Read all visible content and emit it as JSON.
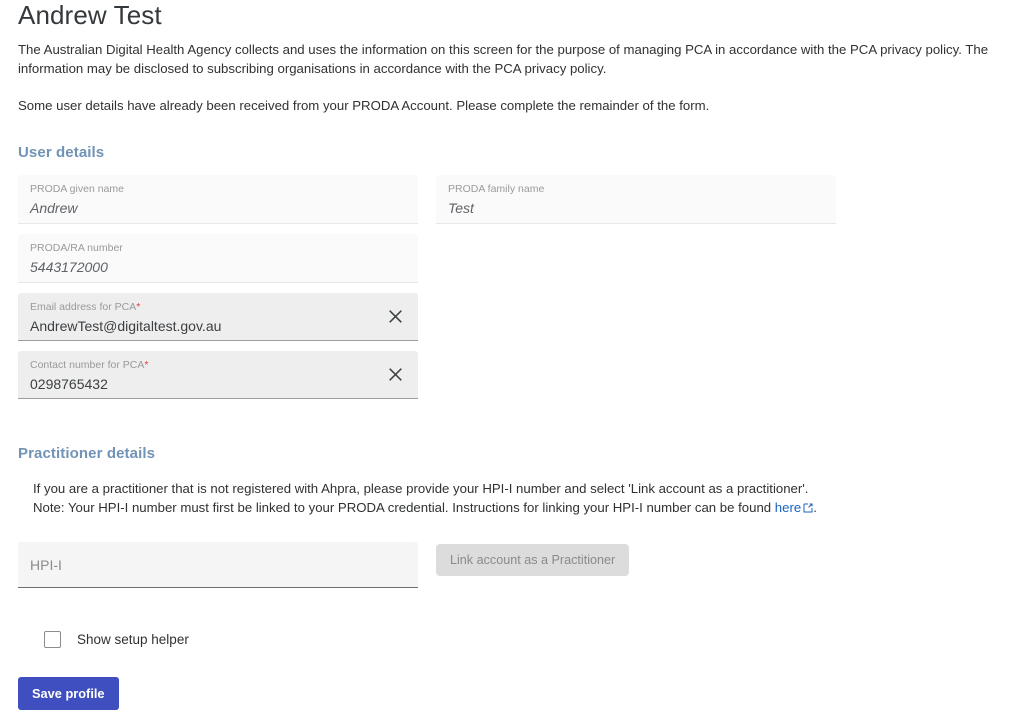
{
  "page": {
    "title": "Andrew Test",
    "intro_paragraph_1": "The Australian Digital Health Agency collects and uses the information on this screen for the purpose of managing PCA in accordance with the PCA privacy policy. The information may be disclosed to subscribing organisations in accordance with the PCA privacy policy.",
    "intro_paragraph_2": "Some user details have already been received from your PRODA Account. Please complete the remainder of the form."
  },
  "user_details": {
    "heading": "User details",
    "fields": [
      {
        "label": "PRODA given name",
        "value": "Andrew",
        "required": false,
        "state": "disabled",
        "clearable": false
      },
      {
        "label": "PRODA family name",
        "value": "Test",
        "required": false,
        "state": "disabled",
        "clearable": false
      },
      {
        "label": "PRODA/RA number",
        "value": "5443172000",
        "required": false,
        "state": "disabled",
        "clearable": false
      },
      {
        "label": "Email address for PCA",
        "value": "AndrewTest@digitaltest.gov.au",
        "required": true,
        "state": "editable",
        "clearable": true
      },
      {
        "label": "Contact number for PCA",
        "value": "0298765432",
        "required": true,
        "state": "editable",
        "clearable": true
      }
    ],
    "required_marker": "*"
  },
  "practitioner_details": {
    "heading": "Practitioner details",
    "line_1": "If you are a practitioner that is not registered with Ahpra, please provide your HPI-I number and select 'Link account as a practitioner'.",
    "line_2_before_link": "Note: Your HPI-I number must first be linked to your PRODA credential. Instructions for linking your HPI-I number can be found ",
    "link_text": "here",
    "line_2_after_link": ".",
    "hpii_placeholder": "HPI-I",
    "hpii_value": "",
    "link_button_label": "Link account as a Practitioner",
    "link_button_disabled": true
  },
  "options": {
    "show_setup_helper_label": "Show setup helper",
    "show_setup_helper_checked": false
  },
  "actions": {
    "save_label": "Save profile"
  },
  "colors": {
    "section_heading": "#7193b5",
    "save_button": "#3f4fbf",
    "link": "#1a63c0",
    "required_star": "#e53935",
    "disabled_button_bg": "#dcdcdc"
  },
  "icons": {
    "clear": "close-icon",
    "external_link": "external-link-icon"
  }
}
